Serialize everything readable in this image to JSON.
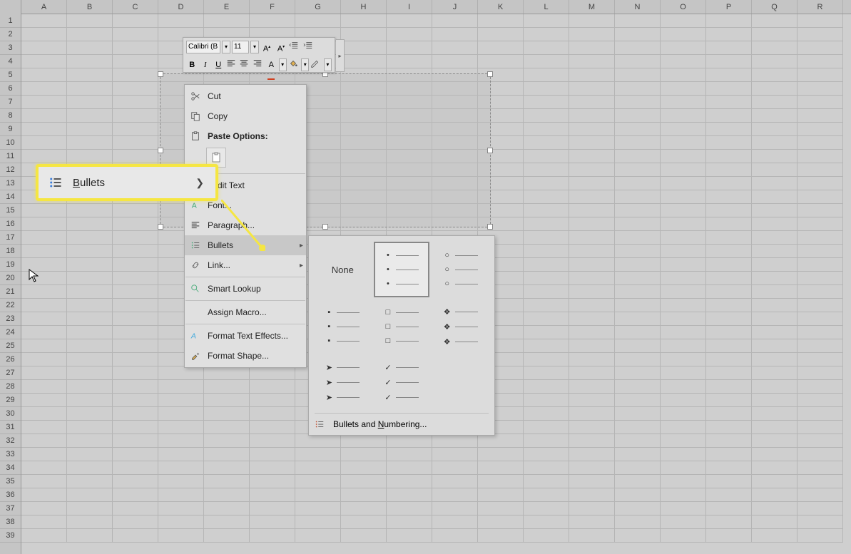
{
  "columns": [
    "A",
    "B",
    "C",
    "D",
    "E",
    "F",
    "G",
    "H",
    "I",
    "J",
    "K",
    "L",
    "M",
    "N",
    "O",
    "P",
    "Q",
    "R"
  ],
  "row_count": 39,
  "mini_toolbar": {
    "font": "Calibri (B",
    "size": "11",
    "bold": "B",
    "italic": "I",
    "underline": "U",
    "font_color_letter": "A"
  },
  "context_menu": {
    "cut": "Cut",
    "copy": "Copy",
    "paste_header": "Paste Options:",
    "edit_text": "Edit Text",
    "font": "Font...",
    "paragraph": "Paragraph...",
    "bullets": "Bullets",
    "link": "Link...",
    "smart_lookup": "Smart Lookup",
    "assign_macro": "Assign Macro...",
    "format_text_effects": "Format Text Effects...",
    "format_shape": "Format Shape..."
  },
  "callout": {
    "label": "Bullets"
  },
  "bullet_submenu": {
    "none": "None",
    "footer": "Bullets and Numbering..."
  }
}
